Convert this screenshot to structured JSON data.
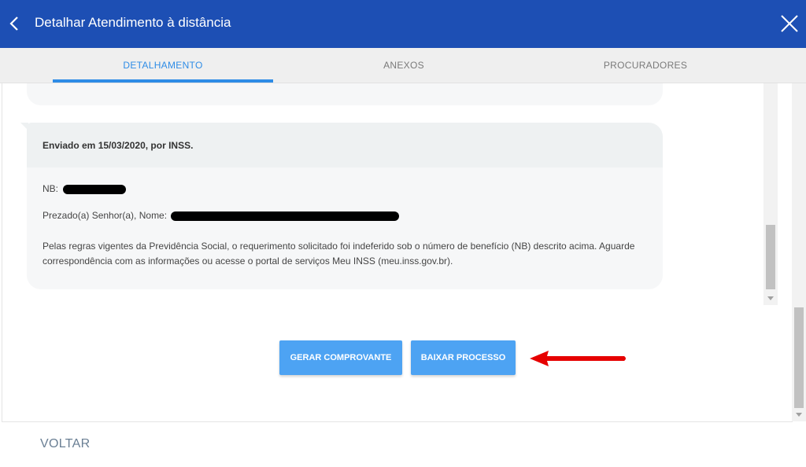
{
  "header": {
    "title": "Detalhar Atendimento à distância",
    "background": "#1d4fb4",
    "back_icon": "chevron-left-icon",
    "close_icon": "close-icon"
  },
  "tabs": [
    {
      "label": "DETALHAMENTO",
      "active": true
    },
    {
      "label": "ANEXOS",
      "active": false
    },
    {
      "label": "PROCURADORES",
      "active": false
    }
  ],
  "accent_color": "#2e8ce6",
  "message": {
    "header": "Enviado em 15/03/2020, por INSS.",
    "nb_label": "NB:",
    "greeting_label": "Prezado(a) Senhor(a), Nome:",
    "body_line_1": "Pelas regras vigentes da Previdência Social, o requerimento solicitado foi indeferido sob o número de benefício (NB) descrito acima. Aguarde",
    "body_line_2": "correspondência com as informações ou acesse o portal de serviços Meu INSS (meu.inss.gov.br)."
  },
  "actions": {
    "gerar_label": "GERAR COMPROVANTE",
    "baixar_label": "BAIXAR PROCESSO",
    "button_color": "#4da3f3",
    "annotation_arrow_color": "#e60000"
  },
  "footer": {
    "voltar_label": "VOLTAR"
  }
}
